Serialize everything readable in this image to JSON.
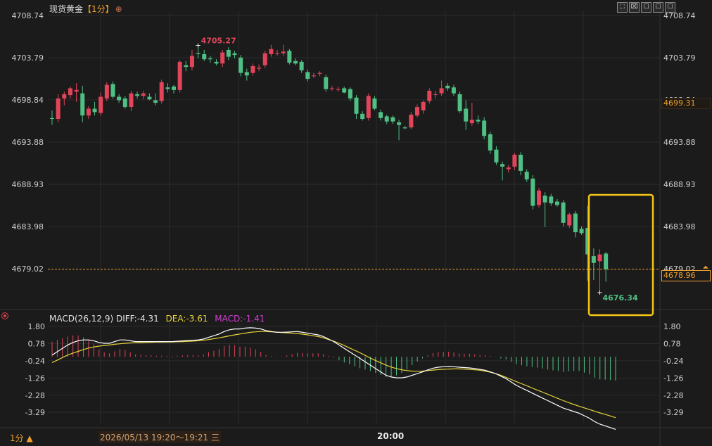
{
  "header": {
    "instrument": "现货黄金",
    "period_tag": "【1分】",
    "plus_icon": "⊕",
    "tools": [
      "⛶",
      "⌧",
      "☐",
      "☐",
      "☐"
    ]
  },
  "price_labels": [
    "4708.74",
    "4703.79",
    "4698.84",
    "4693.88",
    "4688.93",
    "4683.98",
    "4679.02"
  ],
  "current_price_label": "4699.31",
  "last_price_label": "4678.96",
  "high_marker": "4705.27",
  "low_marker": "4676.34",
  "macd_header": {
    "title": "MACD(26,12,9)",
    "diff": "DIFF:-4.31",
    "dea": "DEA:-3.61",
    "macd": "MACD:-1.41"
  },
  "macd_labels": [
    "1.80",
    "0.78",
    "-0.24",
    "-1.26",
    "-2.28",
    "-3.29"
  ],
  "bottom": {
    "period": "1分 ▲",
    "range": "2026/05/13 19:20～19:21 三",
    "time_label": "20:00"
  },
  "colors": {
    "up": "#e2455a",
    "down": "#4fbf83",
    "diff": "#ffffff",
    "dea": "#e6d33a",
    "highlight": "#f5c518",
    "accent": "#f0a030"
  },
  "chart_data": [
    {
      "type": "candlestick",
      "title": "现货黄金 1分",
      "ylim": [
        4674.0,
        4710.5
      ],
      "x_tick_labels": [
        "20:00"
      ],
      "candles": [
        {
          "o": 4696.7,
          "h": 4697.6,
          "l": 4695.9,
          "c": 4696.6
        },
        {
          "o": 4696.6,
          "h": 4699.5,
          "l": 4696.2,
          "c": 4699.0
        },
        {
          "o": 4699.0,
          "h": 4699.8,
          "l": 4698.2,
          "c": 4699.5
        },
        {
          "o": 4699.4,
          "h": 4700.4,
          "l": 4699.0,
          "c": 4700.2
        },
        {
          "o": 4699.8,
          "h": 4700.8,
          "l": 4698.6,
          "c": 4700.0
        },
        {
          "o": 4699.6,
          "h": 4700.5,
          "l": 4696.2,
          "c": 4697.0
        },
        {
          "o": 4697.0,
          "h": 4698.1,
          "l": 4696.6,
          "c": 4697.8
        },
        {
          "o": 4697.8,
          "h": 4698.6,
          "l": 4697.0,
          "c": 4697.4
        },
        {
          "o": 4697.3,
          "h": 4699.7,
          "l": 4697.0,
          "c": 4699.2
        },
        {
          "o": 4699.0,
          "h": 4700.9,
          "l": 4698.7,
          "c": 4700.6
        },
        {
          "o": 4700.7,
          "h": 4701.0,
          "l": 4699.0,
          "c": 4699.2
        },
        {
          "o": 4699.2,
          "h": 4699.5,
          "l": 4698.5,
          "c": 4698.8
        },
        {
          "o": 4699.0,
          "h": 4699.3,
          "l": 4697.8,
          "c": 4698.0
        },
        {
          "o": 4698.0,
          "h": 4699.9,
          "l": 4697.5,
          "c": 4699.6
        },
        {
          "o": 4699.5,
          "h": 4699.8,
          "l": 4699.0,
          "c": 4699.3
        },
        {
          "o": 4699.3,
          "h": 4699.9,
          "l": 4698.9,
          "c": 4699.6
        },
        {
          "o": 4699.2,
          "h": 4699.6,
          "l": 4698.8,
          "c": 4698.9
        },
        {
          "o": 4698.8,
          "h": 4699.6,
          "l": 4698.2,
          "c": 4698.5
        },
        {
          "o": 4698.7,
          "h": 4701.2,
          "l": 4698.4,
          "c": 4700.9
        },
        {
          "o": 4700.3,
          "h": 4700.8,
          "l": 4699.7,
          "c": 4700.1
        },
        {
          "o": 4700.4,
          "h": 4700.6,
          "l": 4699.6,
          "c": 4700.0
        },
        {
          "o": 4700.0,
          "h": 4703.5,
          "l": 4699.7,
          "c": 4703.3
        },
        {
          "o": 4702.9,
          "h": 4703.4,
          "l": 4702.2,
          "c": 4702.7
        },
        {
          "o": 4702.7,
          "h": 4704.7,
          "l": 4702.3,
          "c": 4704.0
        },
        {
          "o": 4704.3,
          "h": 4705.3,
          "l": 4703.7,
          "c": 4704.2
        },
        {
          "o": 4704.2,
          "h": 4704.7,
          "l": 4703.4,
          "c": 4703.6
        },
        {
          "o": 4703.7,
          "h": 4704.0,
          "l": 4703.2,
          "c": 4703.6
        },
        {
          "o": 4703.3,
          "h": 4703.6,
          "l": 4702.9,
          "c": 4703.1
        },
        {
          "o": 4703.1,
          "h": 4704.7,
          "l": 4702.7,
          "c": 4704.4
        },
        {
          "o": 4704.7,
          "h": 4705.0,
          "l": 4703.5,
          "c": 4703.9
        },
        {
          "o": 4704.3,
          "h": 4704.6,
          "l": 4703.7,
          "c": 4704.1
        },
        {
          "o": 4703.8,
          "h": 4704.1,
          "l": 4701.6,
          "c": 4702.0
        },
        {
          "o": 4702.1,
          "h": 4702.5,
          "l": 4701.1,
          "c": 4701.7
        },
        {
          "o": 4702.0,
          "h": 4703.1,
          "l": 4701.7,
          "c": 4702.8
        },
        {
          "o": 4702.5,
          "h": 4703.0,
          "l": 4702.2,
          "c": 4702.6
        },
        {
          "o": 4702.9,
          "h": 4704.6,
          "l": 4702.6,
          "c": 4704.3
        },
        {
          "o": 4704.2,
          "h": 4705.3,
          "l": 4703.9,
          "c": 4704.8
        },
        {
          "o": 4704.3,
          "h": 4704.7,
          "l": 4704.0,
          "c": 4704.3
        },
        {
          "o": 4704.3,
          "h": 4705.3,
          "l": 4704.0,
          "c": 4704.5
        },
        {
          "o": 4704.6,
          "h": 4704.8,
          "l": 4703.0,
          "c": 4703.2
        },
        {
          "o": 4703.4,
          "h": 4703.7,
          "l": 4702.9,
          "c": 4703.1
        },
        {
          "o": 4703.3,
          "h": 4703.5,
          "l": 4702.0,
          "c": 4702.3
        },
        {
          "o": 4702.1,
          "h": 4702.4,
          "l": 4701.0,
          "c": 4701.3
        },
        {
          "o": 4701.7,
          "h": 4702.0,
          "l": 4701.4,
          "c": 4701.7
        },
        {
          "o": 4701.9,
          "h": 4702.2,
          "l": 4701.6,
          "c": 4702.0
        },
        {
          "o": 4701.5,
          "h": 4701.8,
          "l": 4699.8,
          "c": 4700.1
        },
        {
          "o": 4700.2,
          "h": 4700.5,
          "l": 4699.9,
          "c": 4700.2
        },
        {
          "o": 4700.1,
          "h": 4700.4,
          "l": 4699.8,
          "c": 4700.1
        },
        {
          "o": 4700.2,
          "h": 4700.4,
          "l": 4699.6,
          "c": 4699.7
        },
        {
          "o": 4700.1,
          "h": 4700.3,
          "l": 4698.7,
          "c": 4699.0
        },
        {
          "o": 4699.1,
          "h": 4699.4,
          "l": 4696.6,
          "c": 4697.2
        },
        {
          "o": 4697.2,
          "h": 4697.5,
          "l": 4696.4,
          "c": 4696.6
        },
        {
          "o": 4696.7,
          "h": 4699.6,
          "l": 4696.4,
          "c": 4699.3
        },
        {
          "o": 4699.0,
          "h": 4699.3,
          "l": 4697.6,
          "c": 4697.8
        },
        {
          "o": 4697.4,
          "h": 4697.7,
          "l": 4696.4,
          "c": 4696.7
        },
        {
          "o": 4696.9,
          "h": 4697.1,
          "l": 4696.0,
          "c": 4696.3
        },
        {
          "o": 4696.8,
          "h": 4697.0,
          "l": 4696.0,
          "c": 4696.3
        },
        {
          "o": 4696.2,
          "h": 4696.5,
          "l": 4694.1,
          "c": 4695.9
        },
        {
          "o": 4695.6,
          "h": 4695.8,
          "l": 4695.4,
          "c": 4695.5
        },
        {
          "o": 4695.6,
          "h": 4697.4,
          "l": 4695.4,
          "c": 4697.1
        },
        {
          "o": 4697.0,
          "h": 4698.3,
          "l": 4696.8,
          "c": 4698.0
        },
        {
          "o": 4697.6,
          "h": 4698.8,
          "l": 4697.2,
          "c": 4698.6
        },
        {
          "o": 4698.7,
          "h": 4700.2,
          "l": 4698.4,
          "c": 4699.9
        },
        {
          "o": 4699.5,
          "h": 4699.9,
          "l": 4699.0,
          "c": 4699.5
        },
        {
          "o": 4699.6,
          "h": 4701.1,
          "l": 4699.3,
          "c": 4700.2
        },
        {
          "o": 4700.5,
          "h": 4700.8,
          "l": 4699.9,
          "c": 4700.2
        },
        {
          "o": 4700.3,
          "h": 4700.6,
          "l": 4699.3,
          "c": 4699.6
        },
        {
          "o": 4699.5,
          "h": 4699.8,
          "l": 4697.3,
          "c": 4697.5
        },
        {
          "o": 4697.8,
          "h": 4698.8,
          "l": 4695.3,
          "c": 4696.3
        },
        {
          "o": 4696.1,
          "h": 4698.5,
          "l": 4695.8,
          "c": 4696.5
        },
        {
          "o": 4696.5,
          "h": 4697.0,
          "l": 4696.0,
          "c": 4696.3
        },
        {
          "o": 4696.4,
          "h": 4696.8,
          "l": 4694.2,
          "c": 4694.6
        },
        {
          "o": 4694.8,
          "h": 4695.1,
          "l": 4692.5,
          "c": 4692.9
        },
        {
          "o": 4693.0,
          "h": 4693.4,
          "l": 4691.2,
          "c": 4691.5
        },
        {
          "o": 4691.3,
          "h": 4691.6,
          "l": 4689.4,
          "c": 4691.0
        },
        {
          "o": 4690.7,
          "h": 4691.2,
          "l": 4690.3,
          "c": 4690.9
        },
        {
          "o": 4691.0,
          "h": 4692.6,
          "l": 4690.6,
          "c": 4692.4
        },
        {
          "o": 4692.4,
          "h": 4692.7,
          "l": 4690.0,
          "c": 4690.5
        },
        {
          "o": 4690.4,
          "h": 4690.7,
          "l": 4689.2,
          "c": 4689.5
        },
        {
          "o": 4689.6,
          "h": 4690.0,
          "l": 4686.0,
          "c": 4686.4
        },
        {
          "o": 4686.5,
          "h": 4688.5,
          "l": 4686.2,
          "c": 4688.2
        },
        {
          "o": 4687.6,
          "h": 4688.0,
          "l": 4683.9,
          "c": 4686.8
        },
        {
          "o": 4687.5,
          "h": 4687.8,
          "l": 4686.4,
          "c": 4686.7
        },
        {
          "o": 4686.9,
          "h": 4687.2,
          "l": 4686.3,
          "c": 4686.5
        },
        {
          "o": 4686.8,
          "h": 4687.1,
          "l": 4684.0,
          "c": 4684.4
        },
        {
          "o": 4684.1,
          "h": 4685.6,
          "l": 4683.8,
          "c": 4685.4
        },
        {
          "o": 4685.5,
          "h": 4685.8,
          "l": 4682.7,
          "c": 4683.3
        },
        {
          "o": 4683.7,
          "h": 4684.0,
          "l": 4683.0,
          "c": 4683.2
        },
        {
          "o": 4683.8,
          "h": 4686.4,
          "l": 4677.6,
          "c": 4680.7
        },
        {
          "o": 4680.5,
          "h": 4681.4,
          "l": 4677.7,
          "c": 4679.7
        },
        {
          "o": 4679.9,
          "h": 4681.3,
          "l": 4676.3,
          "c": 4680.7
        },
        {
          "o": 4680.8,
          "h": 4681.0,
          "l": 4677.5,
          "c": 4678.96
        }
      ]
    },
    {
      "type": "macd",
      "title": "MACD(26,12,9)",
      "ylim": [
        -3.95,
        2.1
      ],
      "series": [
        {
          "name": "DIFF",
          "values": [
            0.1,
            0.3,
            0.5,
            0.7,
            0.85,
            0.95,
            1.0,
            1.0,
            0.95,
            0.85,
            0.8,
            0.8,
            0.9,
            1.0,
            1.0,
            0.95,
            0.9,
            0.9,
            0.9,
            0.9,
            0.9,
            0.9,
            0.9,
            0.9,
            0.92,
            0.94,
            0.96,
            0.98,
            1.0,
            1.05,
            1.15,
            1.25,
            1.35,
            1.5,
            1.6,
            1.65,
            1.65,
            1.7,
            1.72,
            1.7,
            1.65,
            1.55,
            1.5,
            1.45,
            1.45,
            1.46,
            1.48,
            1.5,
            1.45,
            1.4,
            1.35,
            1.3,
            1.2,
            1.05,
            0.9,
            0.7,
            0.5,
            0.3,
            0.1,
            -0.1,
            -0.3,
            -0.5,
            -0.7,
            -0.9,
            -1.1,
            -1.2,
            -1.25,
            -1.25,
            -1.2,
            -1.1,
            -1.0,
            -0.9,
            -0.78,
            -0.68,
            -0.62,
            -0.59,
            -0.58,
            -0.59,
            -0.62,
            -0.64,
            -0.66,
            -0.7,
            -0.75,
            -0.8,
            -0.9,
            -1.0,
            -1.15,
            -1.3,
            -1.5,
            -1.7,
            -1.85,
            -2.0,
            -2.15,
            -2.3,
            -2.45,
            -2.6,
            -2.75,
            -2.9,
            -3.05,
            -3.15,
            -3.25,
            -3.35,
            -3.5,
            -3.65,
            -3.85,
            -4.0,
            -4.1,
            -4.2,
            -4.31
          ]
        },
        {
          "name": "DEA",
          "values": [
            -0.35,
            -0.2,
            -0.05,
            0.1,
            0.22,
            0.32,
            0.42,
            0.52,
            0.58,
            0.63,
            0.67,
            0.7,
            0.74,
            0.77,
            0.8,
            0.82,
            0.83,
            0.84,
            0.85,
            0.86,
            0.87,
            0.87,
            0.88,
            0.88,
            0.89,
            0.9,
            0.91,
            0.93,
            0.95,
            0.98,
            1.02,
            1.07,
            1.12,
            1.18,
            1.24,
            1.3,
            1.35,
            1.4,
            1.45,
            1.48,
            1.5,
            1.5,
            1.48,
            1.46,
            1.44,
            1.42,
            1.4,
            1.38,
            1.34,
            1.3,
            1.25,
            1.2,
            1.12,
            1.02,
            0.92,
            0.8,
            0.67,
            0.52,
            0.38,
            0.24,
            0.08,
            -0.08,
            -0.22,
            -0.36,
            -0.5,
            -0.61,
            -0.7,
            -0.77,
            -0.82,
            -0.85,
            -0.86,
            -0.85,
            -0.82,
            -0.79,
            -0.76,
            -0.74,
            -0.73,
            -0.72,
            -0.72,
            -0.73,
            -0.75,
            -0.77,
            -0.8,
            -0.85,
            -0.92,
            -1.0,
            -1.1,
            -1.22,
            -1.35,
            -1.48,
            -1.6,
            -1.72,
            -1.85,
            -1.98,
            -2.1,
            -2.22,
            -2.35,
            -2.48,
            -2.6,
            -2.72,
            -2.83,
            -2.93,
            -3.03,
            -3.13,
            -3.23,
            -3.33,
            -3.42,
            -3.51,
            -3.61
          ]
        },
        {
          "name": "MACD",
          "values": [
            0.9,
            1.0,
            1.1,
            1.2,
            1.26,
            1.26,
            1.16,
            0.96,
            0.74,
            0.44,
            0.26,
            0.2,
            0.32,
            0.46,
            0.4,
            0.26,
            0.14,
            0.12,
            0.1,
            0.08,
            0.06,
            0.06,
            0.04,
            0.04,
            0.06,
            0.08,
            0.1,
            0.1,
            0.1,
            0.14,
            0.26,
            0.36,
            0.46,
            0.64,
            0.72,
            0.7,
            0.6,
            0.6,
            0.54,
            0.44,
            0.3,
            0.1,
            0.04,
            -0.02,
            0.02,
            0.08,
            0.16,
            0.24,
            0.22,
            0.2,
            0.2,
            0.2,
            0.16,
            0.06,
            -0.04,
            -0.2,
            -0.34,
            -0.44,
            -0.56,
            -0.68,
            -0.76,
            -0.84,
            -0.96,
            -1.08,
            -1.2,
            -1.18,
            -1.1,
            -0.96,
            -0.76,
            -0.5,
            -0.28,
            -0.1,
            0.08,
            0.22,
            0.28,
            0.3,
            0.3,
            0.26,
            0.2,
            0.18,
            0.18,
            0.14,
            0.1,
            0.1,
            0.04,
            0.0,
            -0.1,
            -0.16,
            -0.3,
            -0.44,
            -0.5,
            -0.56,
            -0.6,
            -0.64,
            -0.7,
            -0.76,
            -0.8,
            -0.84,
            -0.9,
            -0.86,
            -0.84,
            -0.84,
            -0.94,
            -1.04,
            -1.24,
            -1.34,
            -1.36,
            -1.38,
            -1.41
          ]
        }
      ]
    }
  ]
}
